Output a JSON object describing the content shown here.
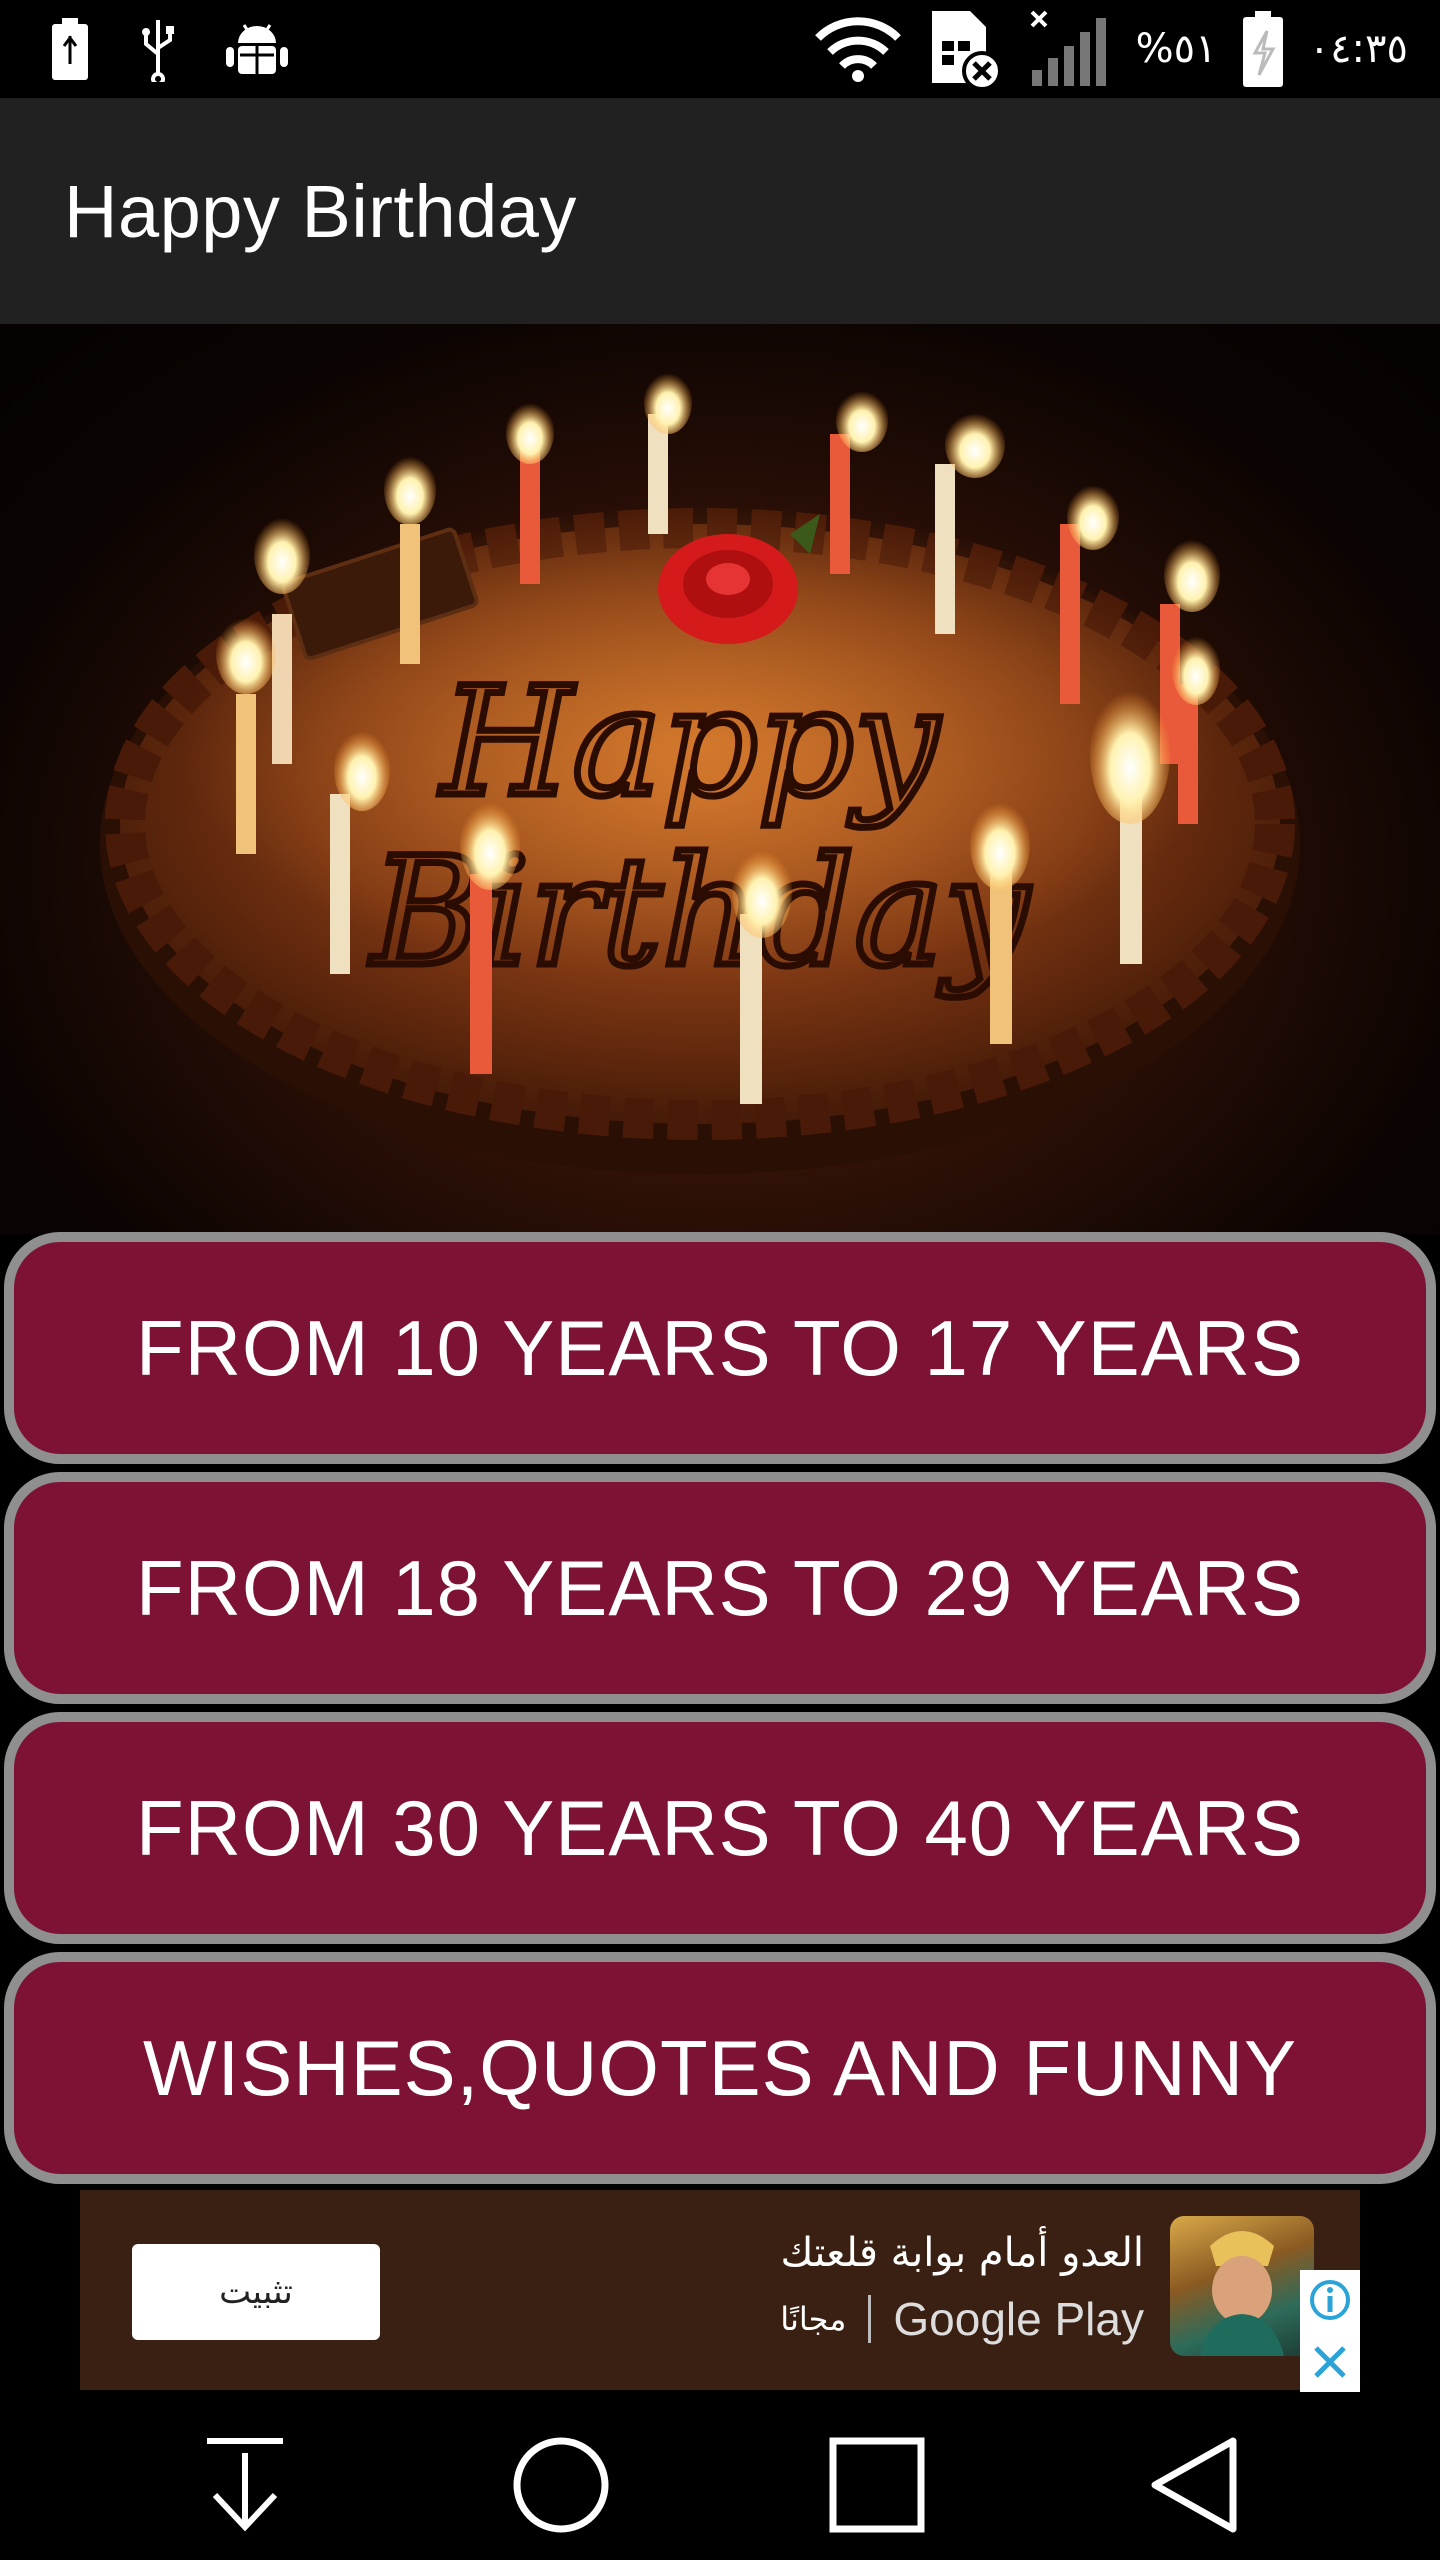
{
  "status_bar": {
    "left_icons": [
      "battery-saver-icon",
      "usb-icon",
      "android-debug-icon"
    ],
    "right_icons": [
      "wifi-icon",
      "sim-card-missing-icon",
      "signal-off-icon"
    ],
    "battery_percent": "%٥١",
    "battery_icon": "battery-charging-icon",
    "time": "٠٤:٣٥"
  },
  "app_bar": {
    "title": "Happy Birthday"
  },
  "hero": {
    "image_name": "birthday-cake-image",
    "cake_text": "Happy Birthday"
  },
  "menu": {
    "items": [
      {
        "label": "FROM 10 YEARS TO 17 YEARS"
      },
      {
        "label": "FROM 18 YEARS TO 29 YEARS"
      },
      {
        "label": "FROM 30 YEARS TO 40 YEARS"
      },
      {
        "label": "WISHES,QUOTES AND FUNNY"
      }
    ],
    "button_color": "#7d1235",
    "border_color": "#8f8f8f"
  },
  "ad": {
    "install_label": "تثبيت",
    "title": "العدو أمام بوابة قلعتك",
    "store": "Google Play",
    "price": "مجانًا",
    "background": "#3a2012"
  },
  "nav_bar": {
    "buttons": [
      "hide-keyboard-icon",
      "home-icon",
      "recents-icon",
      "back-icon"
    ]
  }
}
